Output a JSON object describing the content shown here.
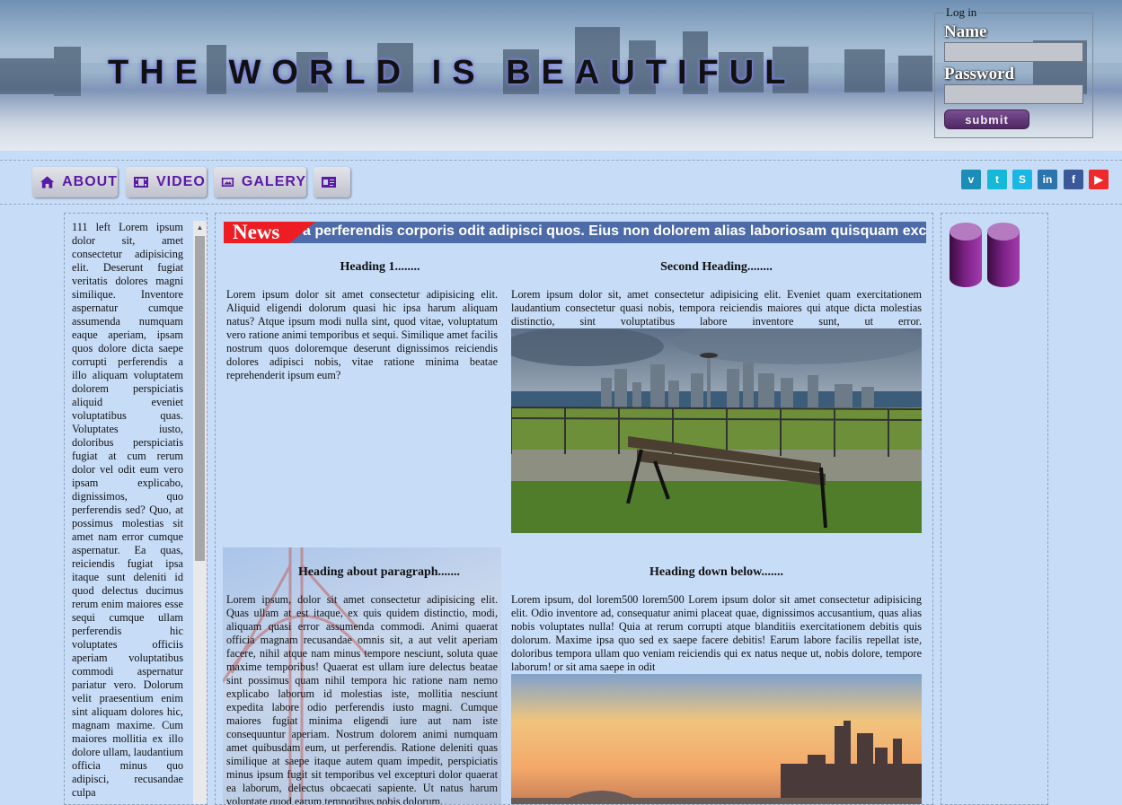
{
  "header": {
    "site_title": "THE WORLD IS BEAUTIFUL",
    "login": {
      "legend": "Log in",
      "name_label": "Name",
      "password_label": "Password",
      "submit_label": "submit"
    }
  },
  "nav": {
    "items": [
      {
        "label": "ABOUT",
        "icon": "home-icon"
      },
      {
        "label": "VIDEO",
        "icon": "film-icon"
      },
      {
        "label": "GALERY",
        "icon": "image-icon"
      },
      {
        "label": "",
        "icon": "id-card-icon"
      }
    ],
    "social": [
      {
        "name": "vimeo-icon",
        "glyph": "v",
        "color": "#1a8db9"
      },
      {
        "name": "twitter-icon",
        "glyph": "t",
        "color": "#14b8d8"
      },
      {
        "name": "skype-icon",
        "glyph": "S",
        "color": "#19b7e6"
      },
      {
        "name": "linkedin-icon",
        "glyph": "in",
        "color": "#2b74ad"
      },
      {
        "name": "facebook-icon",
        "glyph": "f",
        "color": "#3b5998"
      },
      {
        "name": "youtube-icon",
        "glyph": "▶",
        "color": "#ee2a2a"
      }
    ]
  },
  "left_column": {
    "text": "111 left Lorem ipsum dolor sit, amet consectetur adipisicing elit. Deserunt fugiat veritatis dolores magni similique. Inventore aspernatur cumque assumenda numquam eaque aperiam, ipsam quos dolore dicta saepe corrupti perferendis a illo aliquam voluptatem dolorem perspiciatis aliquid eveniet voluptatibus quas. Voluptates iusto, doloribus perspiciatis fugiat at cum rerum dolor vel odit eum vero ipsam explicabo, dignissimos, quo perferendis sed? Quo, at possimus molestias sit amet nam error cumque aspernatur. Ea quas, reiciendis fugiat ipsa itaque sunt deleniti id quod delectus ducimus rerum enim maiores esse sequi cumque ullam perferendis hic voluptates officiis aperiam voluptatibus commodi aspernatur pariatur vero. Dolorum velit praesentium enim sint aliquam dolores hic, magnam maxime. Cum maiores mollitia ex illo dolore ullam, laudantium officia minus quo adipisci, recusandae culpa"
  },
  "news": {
    "label": "News",
    "ticker": "a perferendis corporis odit adipisci quos. Eius non dolorem alias laboriosam quisquam exc"
  },
  "sections": [
    {
      "heading": "Heading 1........",
      "body": "Lorem ipsum dolor sit amet consectetur adipisicing elit. Aliquid eligendi dolorum quasi hic ipsa harum aliquam natus? Atque ipsum modi nulla sint, quod vitae, voluptatum vero ratione animi temporibus et sequi. Similique amet facilis nostrum quos doloremque deserunt dignissimos reiciendis dolores adipisci nobis, vitae ratione minima beatae reprehenderit ipsum eum?"
    },
    {
      "heading": "Second Heading........",
      "body": "Lorem ipsum dolor sit, amet consectetur adipisicing elit. Eveniet quam exercitationem laudantium consectetur quasi nobis, tempora reiciendis maiores qui atque dicta molestias distinctio, sint voluptatibus labore inventore sunt, ut error."
    },
    {
      "heading": "Heading about paragraph.......",
      "body": "Lorem ipsum, dolor sit amet consectetur adipisicing elit. Quas ullam at est itaque, ex quis quidem distinctio, modi, aliquam quasi error assumenda commodi. Animi quaerat officia magnam recusandae omnis sit, a aut velit aperiam facere, nihil atque nam minus tempore nesciunt, soluta quae maxime temporibus! Quaerat est ullam iure delectus beatae sint possimus quam nihil tempora hic ratione nam nemo explicabo laborum id molestias iste, mollitia nesciunt expedita labore odio perferendis iusto magni. Cumque maiores fugiat minima eligendi iure aut nam iste consequuntur aperiam. Nostrum dolorem animi numquam amet quibusdam eum, ut perferendis. Ratione deleniti quas similique at saepe itaque autem quam impedit, perspiciatis minus ipsum fugit sit temporibus vel excepturi dolor quaerat ea laborum, delectus obcaecati sapiente. Ut natus harum voluptate quod earum temporibus nobis dolorum."
    },
    {
      "heading": "Heading down below.......",
      "body": "Lorem ipsum, dol lorem500 lorem500 Lorem ipsum dolor sit amet consectetur adipisicing elit. Odio inventore ad, consequatur animi placeat quae, dignissimos accusantium, quas alias nobis voluptates nulla! Quia at rerum corrupti atque blanditiis exercitationem debitis quis dolorum. Maxime ipsa quo sed ex saepe facere debitis! Earum labore facilis repellat iste, doloribus tempora ullam quo veniam reiciendis qui ex natus neque ut, nobis dolore, tempore laborum! or sit ama saepe in odit"
    }
  ]
}
